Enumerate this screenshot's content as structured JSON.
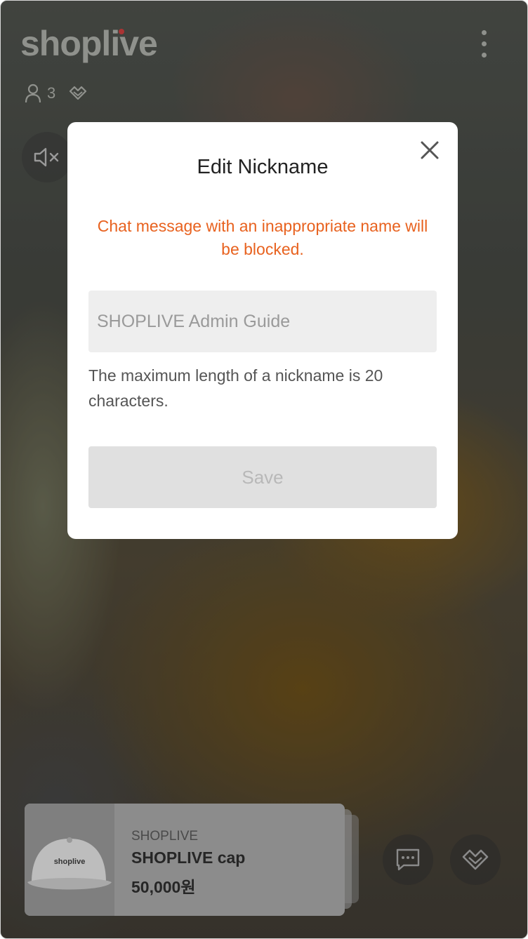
{
  "player": {
    "brand": "shoplive",
    "viewer_count": "3"
  },
  "modal": {
    "title": "Edit Nickname",
    "warning": "Chat message with an inappropriate name will be blocked.",
    "input_placeholder": "SHOPLIVE Admin Guide",
    "input_value": "",
    "hint": "The maximum length of a nickname is 20 characters.",
    "save_label": "Save"
  },
  "product": {
    "brand": "SHOPLIVE",
    "name": "SHOPLIVE cap",
    "price": "50,000원",
    "cap_logo": "shoplive"
  },
  "colors": {
    "warning": "#e8621f",
    "save_disabled_bg": "#e0e0e0"
  },
  "icons": [
    "viewer-icon",
    "heart-icon",
    "more-icon",
    "mute-icon",
    "close-icon",
    "chat-icon",
    "like-icon"
  ]
}
